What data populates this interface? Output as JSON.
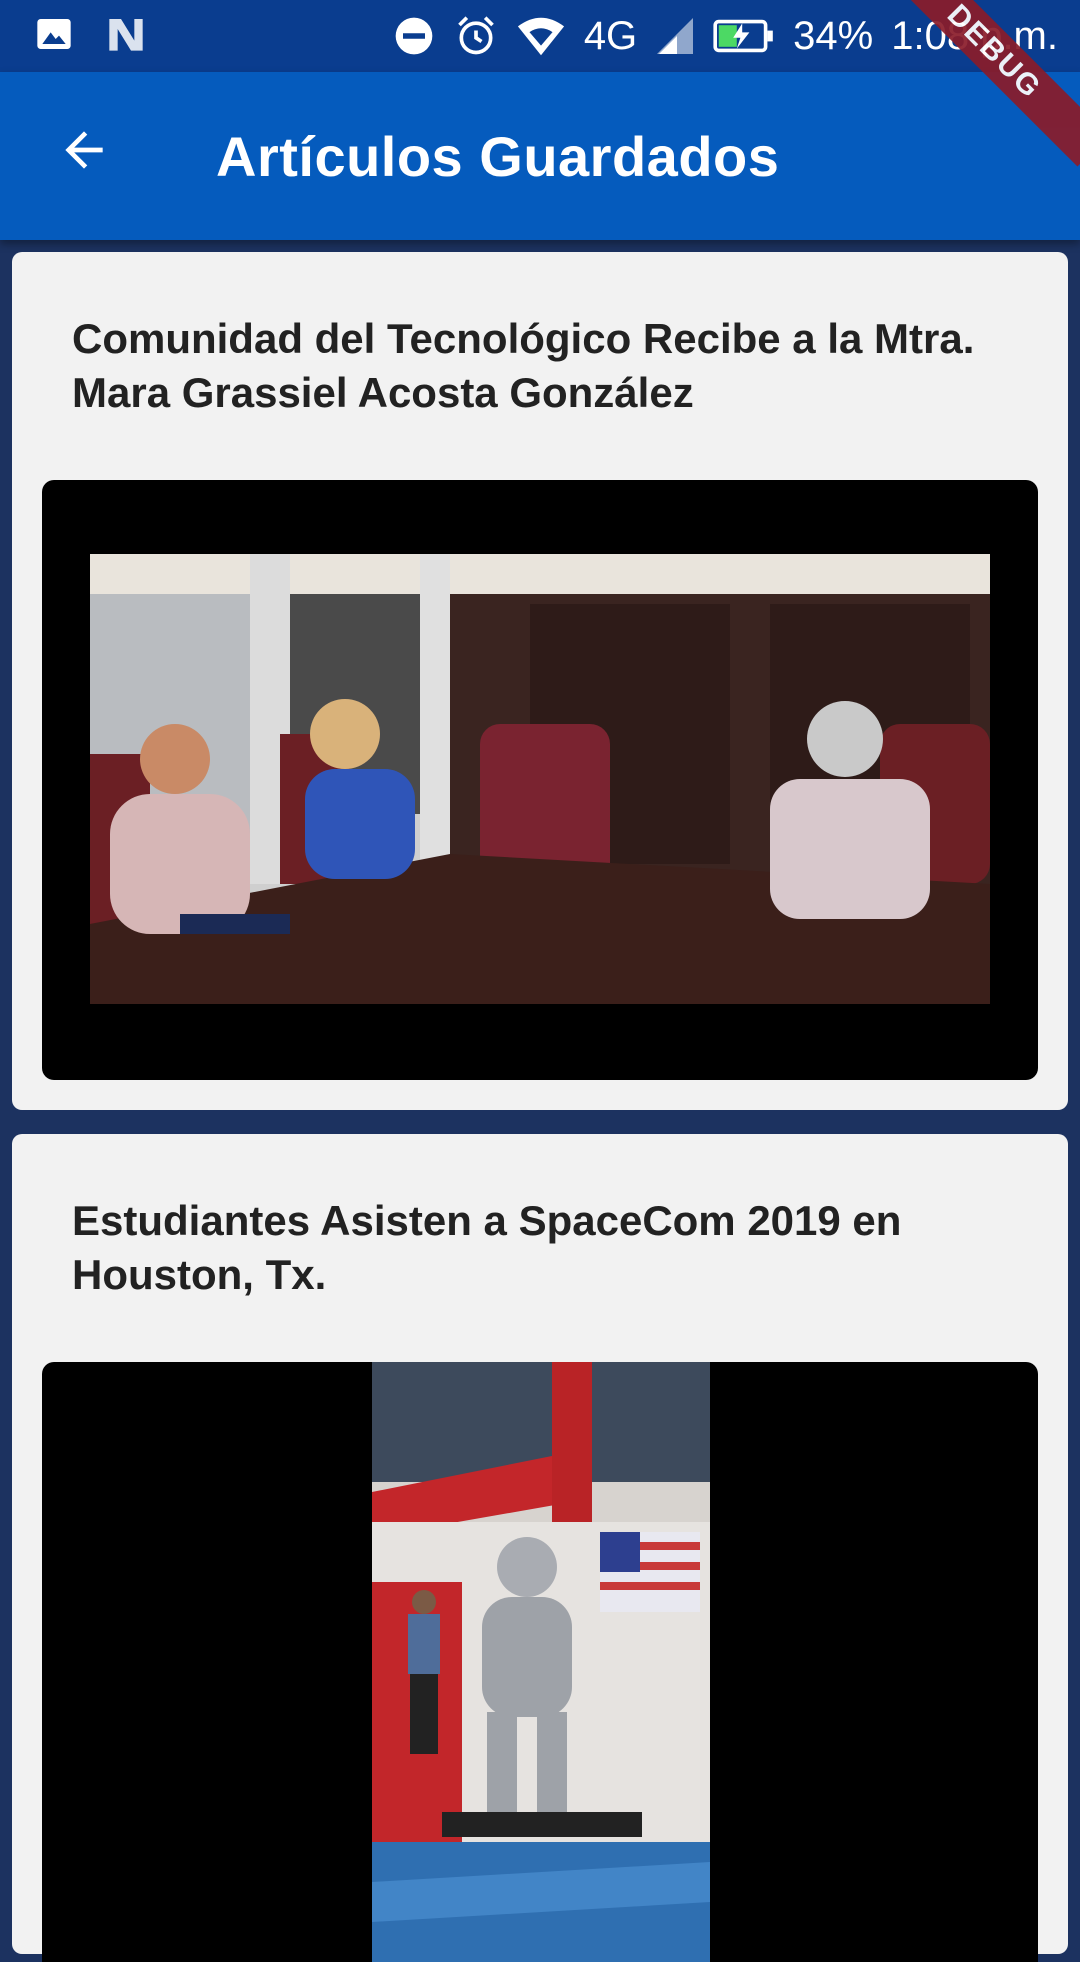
{
  "status_bar": {
    "battery": "34%",
    "time": "1:08 p.m.",
    "network": "4G",
    "icons": [
      "image-icon",
      "notification-n-icon",
      "do-not-disturb-icon",
      "alarm-icon",
      "wifi-icon",
      "signal-icon",
      "battery-charging-icon"
    ]
  },
  "debug_banner": "DEBUG",
  "app_bar": {
    "back_icon": "arrow-left-icon",
    "title": "Artículos Guardados"
  },
  "articles": [
    {
      "title": "Comunidad del Tecnológico Recibe a la Mtra. Mara Grassiel Acosta González"
    },
    {
      "title": "Estudiantes Asisten a SpaceCom 2019 en Houston, Tx."
    }
  ],
  "colors": {
    "status_bar": "#0a3d8f",
    "app_bar": "#055bbd",
    "background": "#1c3260",
    "card": "#f2f2f2",
    "debug_banner": "#8a1c2a"
  }
}
